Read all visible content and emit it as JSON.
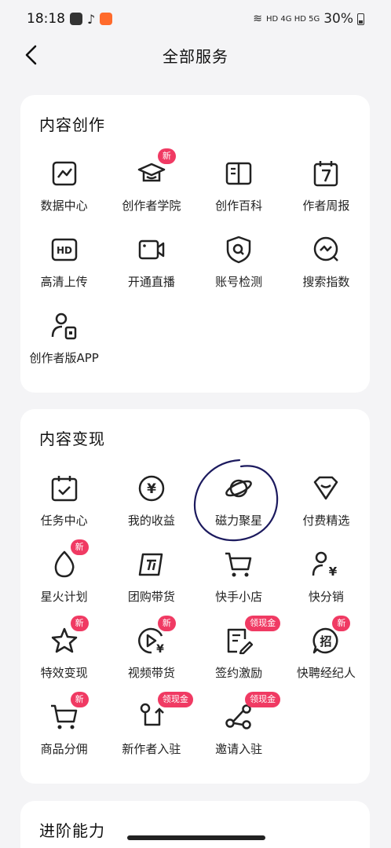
{
  "status": {
    "time": "18:18",
    "network": "HD 4G HD 5G",
    "battery": "30%"
  },
  "nav": {
    "title": "全部服务"
  },
  "sections": [
    {
      "title": "内容创作",
      "items": [
        {
          "label": "数据中心",
          "icon": "chart-icon"
        },
        {
          "label": "创作者学院",
          "icon": "graduation-cap-icon",
          "badge": "新"
        },
        {
          "label": "创作百科",
          "icon": "book-icon"
        },
        {
          "label": "作者周报",
          "icon": "calendar-7-icon"
        },
        {
          "label": "高清上传",
          "icon": "hd-icon"
        },
        {
          "label": "开通直播",
          "icon": "video-camera-icon"
        },
        {
          "label": "账号检测",
          "icon": "shield-search-icon"
        },
        {
          "label": "搜索指数",
          "icon": "search-trend-icon"
        },
        {
          "label": "创作者版APP",
          "icon": "user-phone-icon"
        }
      ]
    },
    {
      "title": "内容变现",
      "items": [
        {
          "label": "任务中心",
          "icon": "calendar-check-icon"
        },
        {
          "label": "我的收益",
          "icon": "yen-coin-icon"
        },
        {
          "label": "磁力聚星",
          "icon": "planet-icon"
        },
        {
          "label": "付费精选",
          "icon": "diamond-icon"
        },
        {
          "label": "星火计划",
          "icon": "flame-icon",
          "badge": "新"
        },
        {
          "label": "团购带货",
          "icon": "group-buy-icon"
        },
        {
          "label": "快手小店",
          "icon": "cart-icon"
        },
        {
          "label": "快分销",
          "icon": "user-yen-icon"
        },
        {
          "label": "特效变现",
          "icon": "star-effect-icon",
          "badge": "新"
        },
        {
          "label": "视频带货",
          "icon": "play-yen-icon",
          "badge": "新"
        },
        {
          "label": "签约激励",
          "icon": "contract-icon",
          "badge": "领现金"
        },
        {
          "label": "快聘经纪人",
          "icon": "recruit-icon",
          "badge": "新"
        },
        {
          "label": "商品分佣",
          "icon": "cart-commission-icon",
          "badge": "新"
        },
        {
          "label": "新作者入驻",
          "icon": "new-author-icon",
          "badge": "领现金"
        },
        {
          "label": "邀请入驻",
          "icon": "share-icon",
          "badge": "领现金"
        }
      ]
    },
    {
      "title": "进阶能力",
      "items": []
    }
  ],
  "colors": {
    "accent": "#f03a63",
    "annotation": "#1c1a5e",
    "icon": "#222222"
  }
}
